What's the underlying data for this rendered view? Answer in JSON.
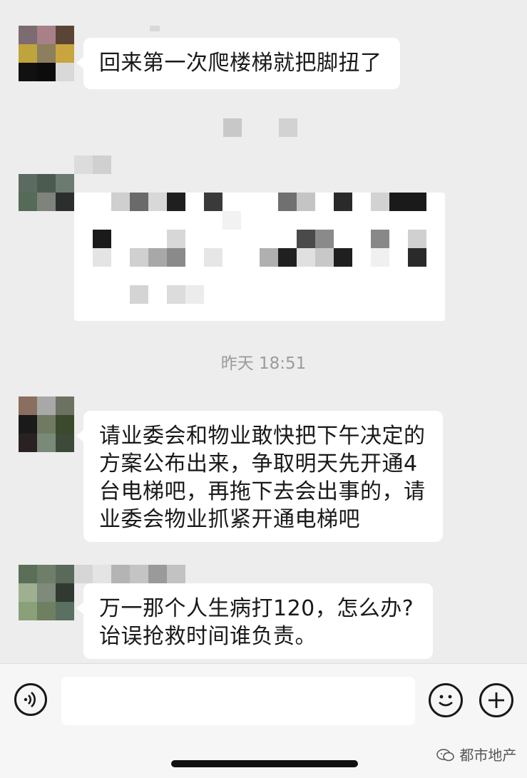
{
  "messages": [
    {
      "lines": [
        "回来第一次爬楼梯就把脚扭了"
      ]
    },
    {
      "lines": []
    },
    {
      "lines": [
        "请业委会和物业敢快把下午决定的",
        "方案公布出来，争取明天先开通4",
        "台电梯吧，再拖下去会出事的，请",
        "业委会物业抓紧开通电梯吧"
      ]
    },
    {
      "lines": [
        "万一那个人生病打120，怎么办?",
        "诒误抢救时间谁负责。"
      ]
    }
  ],
  "timestamp": "昨天 18:51",
  "input_bar": {
    "voice_icon": "voice-icon",
    "emoji_icon": "emoji-icon",
    "plus_icon": "plus-icon",
    "text": ""
  },
  "watermark": {
    "icon": "wechat-icon",
    "text": "都市地产"
  },
  "colors": {
    "background": "#ededed",
    "bubble": "#ffffff",
    "text": "#191919",
    "timestamp": "#9b9b9b"
  }
}
